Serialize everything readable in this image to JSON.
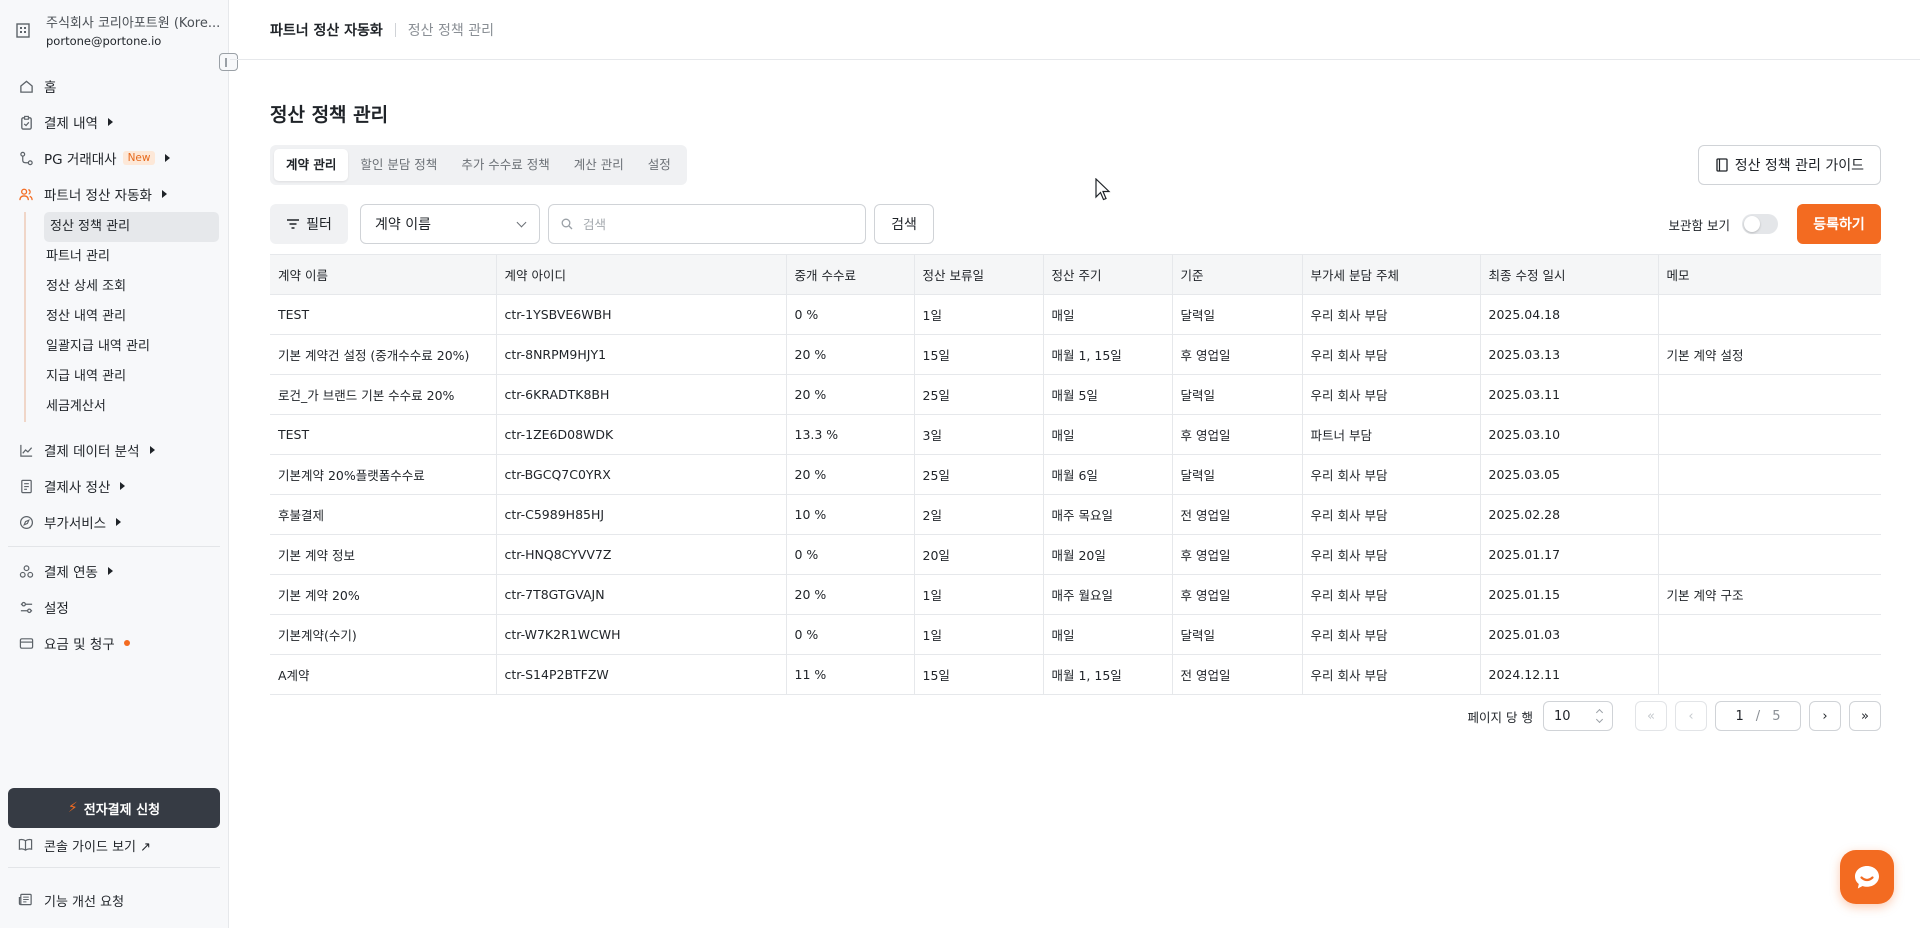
{
  "org": {
    "name": "주식회사 코리아포트원 (Kore...",
    "email": "portone@portone.io"
  },
  "nav": {
    "home": "홈",
    "payments": "결제 내역",
    "pg": "PG 거래대사",
    "pg_badge": "New",
    "partner": "파트너 정산 자동화",
    "sub": [
      "정산 정책 관리",
      "파트너 관리",
      "정산 상세 조회",
      "정산 내역 관리",
      "일괄지급 내역 관리",
      "지급 내역 관리",
      "세금계산서"
    ],
    "analytics": "결제 데이터 분석",
    "settlement": "결제사 정산",
    "addon": "부가서비스",
    "integration": "결제 연동",
    "settings": "설정",
    "billing": "요금 및 청구"
  },
  "sidebar_footer": {
    "apply": "전자결제 신청",
    "guide": "콘솔 가이드 보기 ↗",
    "feedback": "기능 개선 요청"
  },
  "header": {
    "crumb1": "파트너 정산 자동화",
    "crumb2": "정산 정책 관리"
  },
  "page": {
    "title": "정산 정책 관리",
    "guide_button": "정산 정책 관리 가이드"
  },
  "tabs": [
    "계약 관리",
    "할인 분담 정책",
    "추가 수수료 정책",
    "계산 관리",
    "설정"
  ],
  "toolbar": {
    "filter": "필터",
    "select_value": "계약 이름",
    "search_placeholder": "검색",
    "search_button": "검색",
    "archive_label": "보관함 보기",
    "register": "등록하기"
  },
  "table": {
    "columns": [
      "계약 이름",
      "계약 아이디",
      "중개 수수료",
      "정산 보류일",
      "정산 주기",
      "기준",
      "부가세 분담 주체",
      "최종 수정 일시",
      "메모"
    ],
    "rows": [
      [
        "TEST",
        "ctr-1YSBVE6WBH",
        "0 %",
        "1일",
        "매일",
        "달력일",
        "우리 회사 부담",
        "2025.04.18",
        ""
      ],
      [
        "기본 계약건 설정 (중개수수료 20%)",
        "ctr-8NRPM9HJY1",
        "20 %",
        "15일",
        "매월 1, 15일",
        "후 영업일",
        "우리 회사 부담",
        "2025.03.13",
        "기본 계약 설정"
      ],
      [
        "로건_가 브랜드 기본 수수료 20%",
        "ctr-6KRADTK8BH",
        "20 %",
        "25일",
        "매월 5일",
        "달력일",
        "우리 회사 부담",
        "2025.03.11",
        ""
      ],
      [
        "TEST",
        "ctr-1ZE6D08WDK",
        "13.3 %",
        "3일",
        "매일",
        "후 영업일",
        "파트너 부담",
        "2025.03.10",
        ""
      ],
      [
        "기본계약 20%플랫폼수수료",
        "ctr-BGCQ7C0YRX",
        "20 %",
        "25일",
        "매월 6일",
        "달력일",
        "우리 회사 부담",
        "2025.03.05",
        ""
      ],
      [
        "후불결제",
        "ctr-C5989H85HJ",
        "10 %",
        "2일",
        "매주 목요일",
        "전 영업일",
        "우리 회사 부담",
        "2025.02.28",
        ""
      ],
      [
        "기본 계약 정보",
        "ctr-HNQ8CYVV7Z",
        "0 %",
        "20일",
        "매월 20일",
        "후 영업일",
        "우리 회사 부담",
        "2025.01.17",
        ""
      ],
      [
        "기본 계약 20%",
        "ctr-7T8GTGVAJN",
        "20 %",
        "1일",
        "매주 월요일",
        "후 영업일",
        "우리 회사 부담",
        "2025.01.15",
        "기본 계약 구조"
      ],
      [
        "기본계약(수기)",
        "ctr-W7K2R1WCWH",
        "0 %",
        "1일",
        "매일",
        "달력일",
        "우리 회사 부담",
        "2025.01.03",
        ""
      ],
      [
        "A계약",
        "ctr-S14P2BTFZW",
        "11 %",
        "15일",
        "매월 1, 15일",
        "전 영업일",
        "우리 회사 부담",
        "2024.12.11",
        ""
      ]
    ]
  },
  "pagination": {
    "rows_label": "페이지 당 행",
    "rows_value": "10",
    "current": "1",
    "slash": "/",
    "total": "5",
    "first": "«",
    "prev": "‹",
    "next": "›",
    "last": "»"
  },
  "colors": {
    "accent": "#f36b21",
    "dark_button": "#363b44"
  }
}
